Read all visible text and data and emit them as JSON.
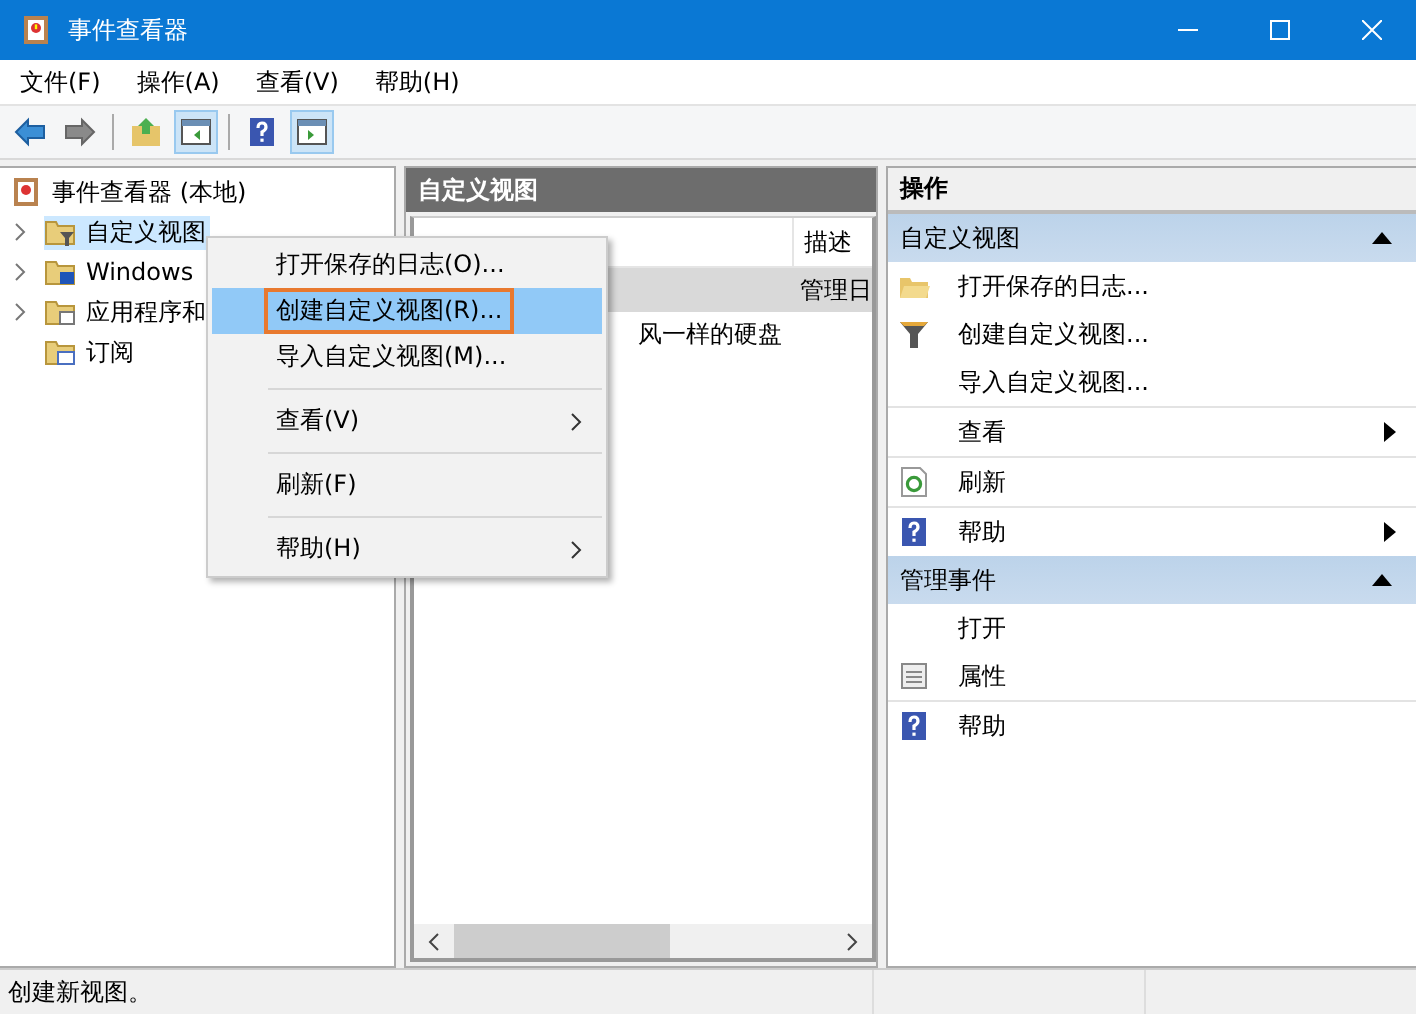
{
  "window": {
    "title": "事件查看器"
  },
  "menu_bar": [
    "文件(F)",
    "操作(A)",
    "查看(V)",
    "帮助(H)"
  ],
  "toolbar": [
    {
      "kind": "back",
      "pressed": false
    },
    {
      "kind": "forward",
      "pressed": false
    },
    {
      "kind": "sep"
    },
    {
      "kind": "folder-up",
      "pressed": false
    },
    {
      "kind": "pane",
      "pressed": true
    },
    {
      "kind": "sep"
    },
    {
      "kind": "help",
      "pressed": false
    },
    {
      "kind": "pane2",
      "pressed": true
    }
  ],
  "tree": {
    "label": "事件查看器 (本地)",
    "children": [
      {
        "label": "自定义视图",
        "kind": "filter-folder",
        "selected": true,
        "has_children": true
      },
      {
        "label": "Windows",
        "kind": "win-folder",
        "selected": false,
        "has_children": true
      },
      {
        "label": "应用程序和",
        "kind": "app-folder",
        "selected": false,
        "has_children": true
      },
      {
        "label": "订阅",
        "kind": "sub-folder",
        "selected": false,
        "has_children": false
      }
    ]
  },
  "middle": {
    "title": "自定义视图",
    "columns": [
      "描述"
    ],
    "rows": [
      {
        "description": "管理日",
        "selected": true
      },
      {
        "name": "风一样的硬盘",
        "selected": false
      }
    ]
  },
  "context_menu": [
    {
      "kind": "item",
      "label": "打开保存的日志(O)...",
      "selected": false,
      "submenu": false
    },
    {
      "kind": "item",
      "label": "创建自定义视图(R)...",
      "selected": true,
      "submenu": false
    },
    {
      "kind": "item",
      "label": "导入自定义视图(M)...",
      "selected": false,
      "submenu": false
    },
    {
      "kind": "separator"
    },
    {
      "kind": "item",
      "label": "查看(V)",
      "selected": false,
      "submenu": true
    },
    {
      "kind": "separator"
    },
    {
      "kind": "item",
      "label": "刷新(F)",
      "selected": false,
      "submenu": false
    },
    {
      "kind": "separator"
    },
    {
      "kind": "item",
      "label": "帮助(H)",
      "selected": false,
      "submenu": true
    }
  ],
  "actions": {
    "title": "操作",
    "sections": [
      {
        "title": "自定义视图",
        "expanded": true,
        "items": [
          {
            "label": "打开保存的日志...",
            "kind": "folder",
            "submenu": false
          },
          {
            "label": "创建自定义视图...",
            "kind": "filter",
            "submenu": false
          },
          {
            "label": "导入自定义视图...",
            "kind": "plain",
            "submenu": false
          },
          {
            "kind": "separator"
          },
          {
            "label": "查看",
            "kind": "plain",
            "submenu": true
          },
          {
            "kind": "separator"
          },
          {
            "label": "刷新",
            "kind": "refresh",
            "submenu": false
          },
          {
            "kind": "separator"
          },
          {
            "label": "帮助",
            "kind": "help",
            "submenu": true
          }
        ]
      },
      {
        "title": "管理事件",
        "expanded": true,
        "items": [
          {
            "label": "打开",
            "kind": "plain",
            "submenu": false
          },
          {
            "label": "属性",
            "kind": "properties",
            "submenu": false
          },
          {
            "kind": "separator"
          },
          {
            "label": "帮助",
            "kind": "help",
            "submenu": false
          }
        ]
      }
    ]
  },
  "status_bar": "创建新视图。"
}
